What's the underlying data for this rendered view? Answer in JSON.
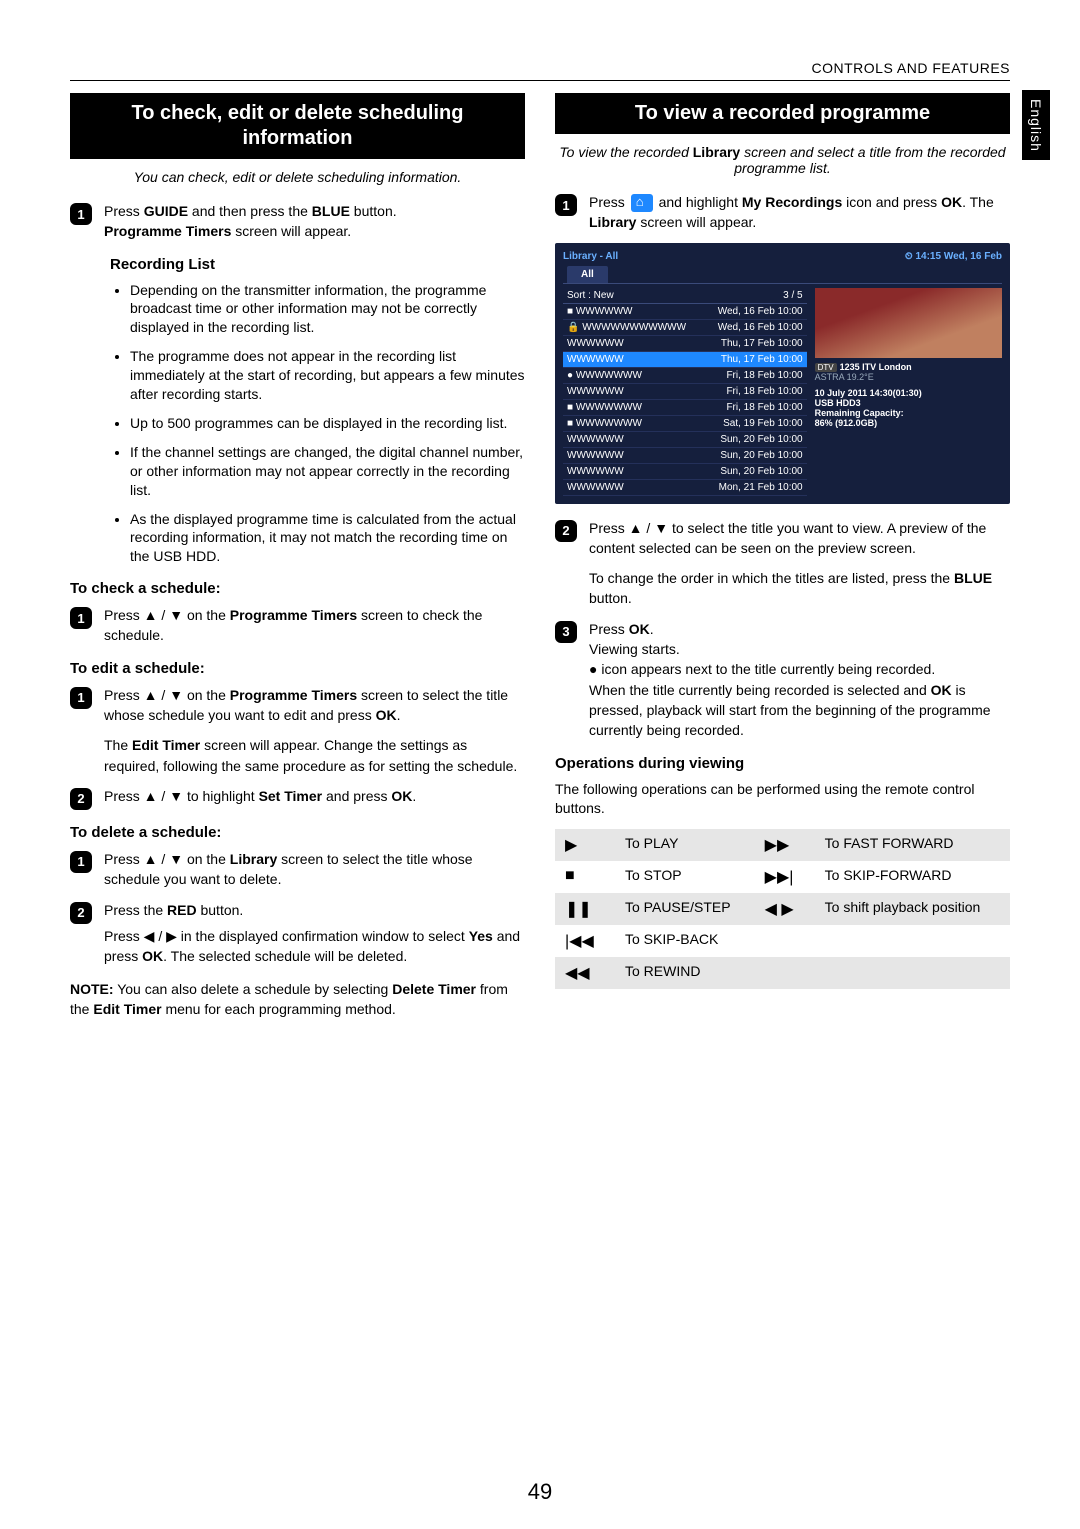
{
  "header": "CONTROLS AND FEATURES",
  "side_tab": "English",
  "page_number": "49",
  "left": {
    "title": "To check, edit or delete scheduling information",
    "intro": "You can check, edit or delete scheduling information.",
    "step1_a": "Press ",
    "step1_guide": "GUIDE",
    "step1_b": " and then press the ",
    "step1_blue": "BLUE",
    "step1_c": " button. ",
    "step1_pt": "Programme Timers",
    "step1_d": " screen will appear.",
    "rec_list_head": "Recording List",
    "bullets": [
      "Depending on the transmitter information, the programme broadcast time or other information may not be correctly displayed in the recording list.",
      "The programme does not appear in the recording list immediately at the start of recording, but appears a few minutes after recording starts.",
      "Up to 500 programmes can be displayed in the recording list.",
      "If the channel settings are changed, the digital channel number, or other information may not appear correctly in the recording list.",
      "As the displayed programme time is calculated from the actual recording information, it may not match the recording time on the USB HDD."
    ],
    "check_head": "To check a schedule:",
    "check_body_a": "Press ▲ / ▼ on the ",
    "check_body_b": "Programme Timers",
    "check_body_c": " screen to check the schedule.",
    "edit_head": "To edit a schedule:",
    "edit1_a": "Press ▲ / ▼ on the ",
    "edit1_b": "Programme Timers",
    "edit1_c": " screen to select the title whose schedule you want to edit and press ",
    "edit1_ok": "OK",
    "edit1_d": ".",
    "edit1_para2_a": "The ",
    "edit1_para2_b": "Edit Timer",
    "edit1_para2_c": " screen will appear. Change the settings as required, following the same procedure as for setting the schedule.",
    "edit2_a": "Press ▲ / ▼ to highlight ",
    "edit2_b": "Set Timer",
    "edit2_c": " and press ",
    "edit2_ok": "OK",
    "edit2_d": ".",
    "del_head": "To delete a schedule:",
    "del1_a": "Press ▲ / ▼ on the ",
    "del1_b": "Library",
    "del1_c": " screen to select the title whose schedule you want to delete.",
    "del2_a": "Press the ",
    "del2_b": "RED",
    "del2_c": " button.",
    "del2_p2_a": "Press ◀ / ▶ in the displayed confirmation window to select ",
    "del2_p2_b": "Yes",
    "del2_p2_c": " and press ",
    "del2_p2_ok": "OK",
    "del2_p2_d": ". The selected schedule will be deleted.",
    "note_a": "NOTE:",
    "note_b": " You can also delete a schedule by selecting ",
    "note_c": "Delete Timer",
    "note_d": " from the ",
    "note_e": "Edit Timer",
    "note_f": " menu for each programming method."
  },
  "right": {
    "title": "To view a recorded programme",
    "intro_a": "To view the recorded ",
    "intro_b": "Library",
    "intro_c": " screen and select a title from the recorded programme list.",
    "s1_a": "Press ",
    "s1_b": " and highlight ",
    "s1_c": "My Recordings",
    "s1_d": " icon and press ",
    "s1_ok": "OK",
    "s1_e": ". The ",
    "s1_f": "Library",
    "s1_g": " screen will appear.",
    "lib": {
      "crumb": "Library - All",
      "clock": "⏲ 14:15 Wed, 16 Feb",
      "tab": "All",
      "sort": "Sort : New",
      "count": "3 / 5",
      "rows": [
        {
          "pre": "■",
          "name": "WWWWWW",
          "date": "Wed, 16 Feb 10:00"
        },
        {
          "pre": "🔒",
          "name": "WWWWWWWWWWW",
          "date": "Wed, 16 Feb 10:00"
        },
        {
          "pre": "",
          "name": "WWWWWW",
          "date": "Thu, 17 Feb 10:00"
        },
        {
          "pre": "",
          "name": "WWWWWW",
          "date": "Thu, 17 Feb 10:00",
          "hl": true
        },
        {
          "pre": "●",
          "name": "WWWWWWW",
          "date": "Fri, 18 Feb 10:00"
        },
        {
          "pre": "",
          "name": "WWWWWW",
          "date": "Fri, 18 Feb 10:00"
        },
        {
          "pre": "■",
          "name": "WWWWWWW",
          "date": "Fri, 18 Feb 10:00"
        },
        {
          "pre": "■",
          "name": "WWWWWWW",
          "date": "Sat, 19 Feb 10:00"
        },
        {
          "pre": "",
          "name": "WWWWWW",
          "date": "Sun, 20 Feb 10:00"
        },
        {
          "pre": "",
          "name": "WWWWWW",
          "date": "Sun, 20 Feb 10:00"
        },
        {
          "pre": "",
          "name": "WWWWWW",
          "date": "Sun, 20 Feb 10:00"
        },
        {
          "pre": "",
          "name": "WWWWWW",
          "date": "Mon, 21 Feb 10:00"
        }
      ],
      "ch_badge": "DTV",
      "ch_name": "1235 ITV London",
      "sat": "ASTRA 19.2°E",
      "ts": "10 July 2011  14:30(01:30)",
      "hdd": "USB HDD3",
      "cap_l": "Remaining Capacity:",
      "cap_v": "86% (912.0GB)"
    },
    "s2_p1": "Press ▲ / ▼ to select the title you want to view. A preview of the content selected can be seen on the preview screen.",
    "s2_p2_a": "To change the order in which the titles are listed, press the ",
    "s2_p2_b": "BLUE",
    "s2_p2_c": " button.",
    "s3_l1_a": "Press ",
    "s3_l1_ok": "OK",
    "s3_l1_b": ".",
    "s3_l2": "Viewing starts.",
    "s3_l3": "● icon appears next to the title currently being recorded.",
    "s3_l4_a": "When the title currently being recorded is selected and ",
    "s3_l4_ok": "OK",
    "s3_l4_b": " is pressed, playback will start from the beginning of the programme currently being recorded.",
    "ops_head": "Operations during viewing",
    "ops_intro": "The following operations can be performed using the remote control buttons.",
    "ops": [
      {
        "s1": "▶",
        "t1": "To PLAY",
        "s2": "▶▶",
        "t2": "To FAST FORWARD",
        "shade": true
      },
      {
        "s1": "■",
        "t1": "To STOP",
        "s2": "▶▶|",
        "t2": "To SKIP-FORWARD",
        "shade": false
      },
      {
        "s1": "❚❚",
        "t1": "To PAUSE/STEP",
        "s2": "◀ ▶",
        "t2": "To shift playback position",
        "shade": true
      },
      {
        "s1": "|◀◀",
        "t1": "To SKIP-BACK",
        "s2": "",
        "t2": "",
        "shade": false
      },
      {
        "s1": "◀◀",
        "t1": "To REWIND",
        "s2": "",
        "t2": "",
        "shade": true
      }
    ]
  }
}
